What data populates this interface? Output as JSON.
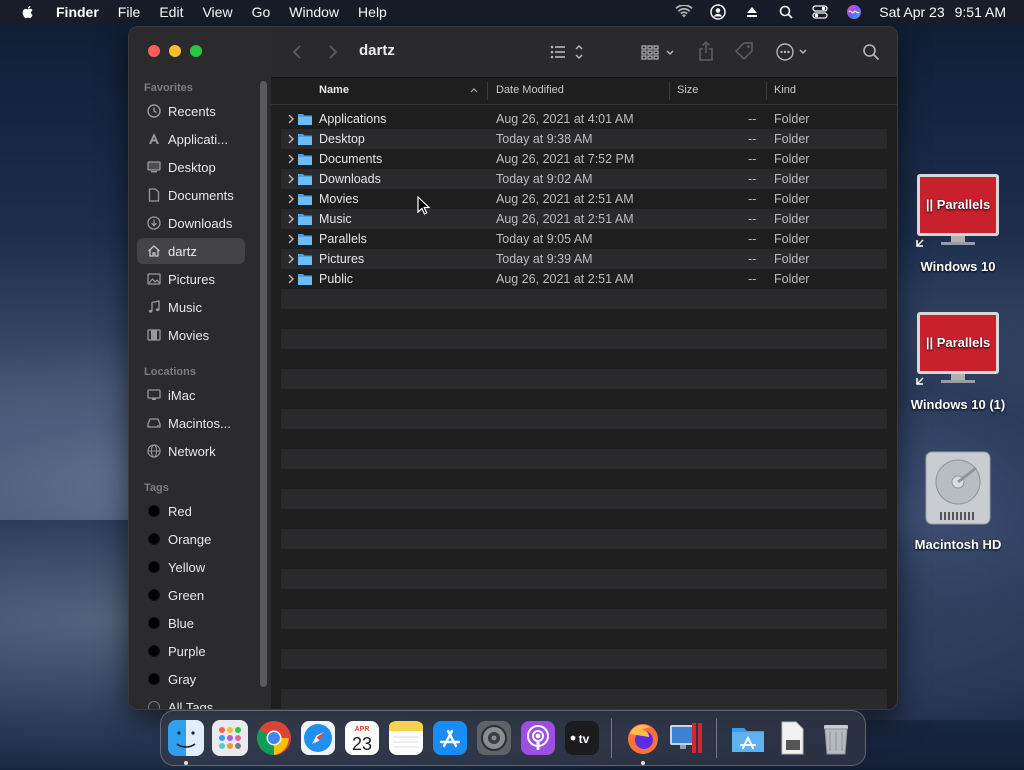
{
  "menubar": {
    "items": [
      {
        "label": "Finder",
        "bold": true
      },
      {
        "label": "File"
      },
      {
        "label": "Edit"
      },
      {
        "label": "View"
      },
      {
        "label": "Go"
      },
      {
        "label": "Window"
      },
      {
        "label": "Help"
      }
    ],
    "date": "Sat Apr 23",
    "time": "9:51 AM",
    "status_icons": [
      "wifi-icon",
      "user-icon",
      "eject-icon",
      "search-icon",
      "control-center-icon",
      "siri-icon"
    ]
  },
  "window": {
    "title": "dartz",
    "sidebar": {
      "favorites_header": "Favorites",
      "favorites": [
        {
          "label": "Recents",
          "icon": "clock-icon"
        },
        {
          "label": "Applicati...",
          "icon": "applications-icon"
        },
        {
          "label": "Desktop",
          "icon": "desktop-icon"
        },
        {
          "label": "Documents",
          "icon": "document-icon"
        },
        {
          "label": "Downloads",
          "icon": "download-icon"
        },
        {
          "label": "dartz",
          "icon": "home-icon",
          "selected": true
        },
        {
          "label": "Pictures",
          "icon": "pictures-icon"
        },
        {
          "label": "Music",
          "icon": "music-icon"
        },
        {
          "label": "Movies",
          "icon": "movies-icon"
        }
      ],
      "locations_header": "Locations",
      "locations": [
        {
          "label": "iMac",
          "icon": "imac-icon"
        },
        {
          "label": "Macintos...",
          "icon": "disk-icon"
        },
        {
          "label": "Network",
          "icon": "network-icon"
        }
      ],
      "tags_header": "Tags",
      "tags": [
        {
          "label": "Red"
        },
        {
          "label": "Orange"
        },
        {
          "label": "Yellow"
        },
        {
          "label": "Green"
        },
        {
          "label": "Blue"
        },
        {
          "label": "Purple"
        },
        {
          "label": "Gray"
        },
        {
          "label": "All Tags..."
        }
      ]
    },
    "columns": {
      "name": "Name",
      "date": "Date Modified",
      "size": "Size",
      "kind": "Kind"
    },
    "files": [
      {
        "name": "Applications",
        "date": "Aug 26, 2021 at 4:01 AM",
        "size": "--",
        "kind": "Folder"
      },
      {
        "name": "Desktop",
        "date": "Today at 9:38 AM",
        "size": "--",
        "kind": "Folder"
      },
      {
        "name": "Documents",
        "date": "Aug 26, 2021 at 7:52 PM",
        "size": "--",
        "kind": "Folder"
      },
      {
        "name": "Downloads",
        "date": "Today at 9:02 AM",
        "size": "--",
        "kind": "Folder"
      },
      {
        "name": "Movies",
        "date": "Aug 26, 2021 at 2:51 AM",
        "size": "--",
        "kind": "Folder"
      },
      {
        "name": "Music",
        "date": "Aug 26, 2021 at 2:51 AM",
        "size": "--",
        "kind": "Folder"
      },
      {
        "name": "Parallels",
        "date": "Today at 9:05 AM",
        "size": "--",
        "kind": "Folder"
      },
      {
        "name": "Pictures",
        "date": "Today at 9:39 AM",
        "size": "--",
        "kind": "Folder"
      },
      {
        "name": "Public",
        "date": "Aug 26, 2021 at 2:51 AM",
        "size": "--",
        "kind": "Folder"
      }
    ]
  },
  "desktop_icons": [
    {
      "label": "Windows 10",
      "badge": "|| Parallels"
    },
    {
      "label": "Windows 10 (1)",
      "badge": "|| Parallels"
    },
    {
      "label": "Macintosh HD"
    }
  ],
  "dock": {
    "calendar_month": "APR",
    "calendar_day": "23",
    "tv_label": "tv"
  }
}
